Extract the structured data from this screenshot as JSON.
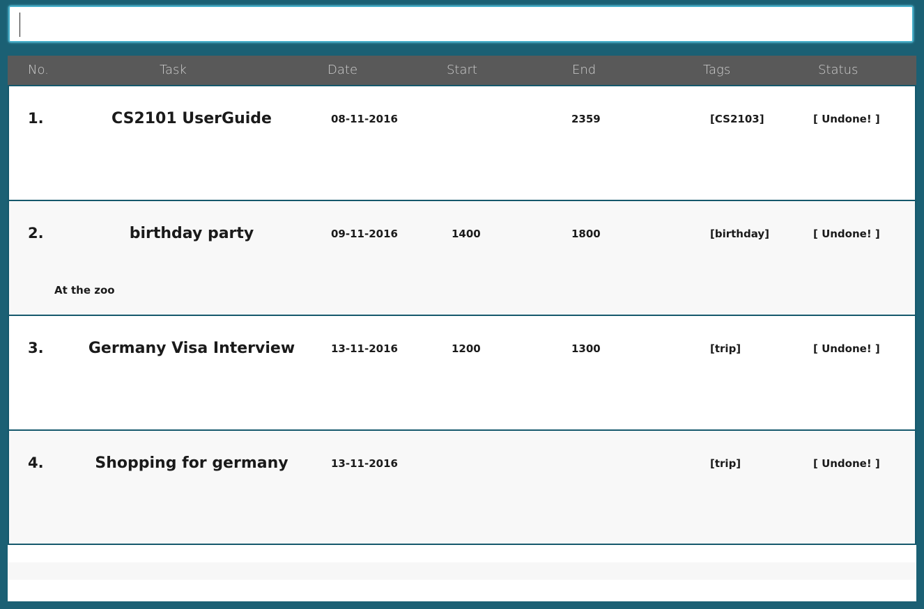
{
  "command": {
    "value": ""
  },
  "columns": {
    "no": "No.",
    "task": "Task",
    "date": "Date",
    "start": "Start",
    "end": "End",
    "tags": "Tags",
    "status": "Status"
  },
  "tasks": [
    {
      "index": "1.",
      "name": "CS2101 UserGuide",
      "date": "08-11-2016",
      "start": "",
      "end": "2359",
      "tags": "[CS2103]",
      "status": "[ Undone! ]",
      "note": ""
    },
    {
      "index": "2.",
      "name": "birthday party",
      "date": "09-11-2016",
      "start": "1400",
      "end": "1800",
      "tags": "[birthday]",
      "status": "[ Undone! ]",
      "note": "At the zoo"
    },
    {
      "index": "3.",
      "name": "Germany Visa Interview",
      "date": "13-11-2016",
      "start": "1200",
      "end": "1300",
      "tags": "[trip]",
      "status": "[ Undone! ]",
      "note": ""
    },
    {
      "index": "4.",
      "name": "Shopping for germany",
      "date": "13-11-2016",
      "start": "",
      "end": "",
      "tags": "[trip]",
      "status": "[ Undone! ]",
      "note": ""
    }
  ]
}
